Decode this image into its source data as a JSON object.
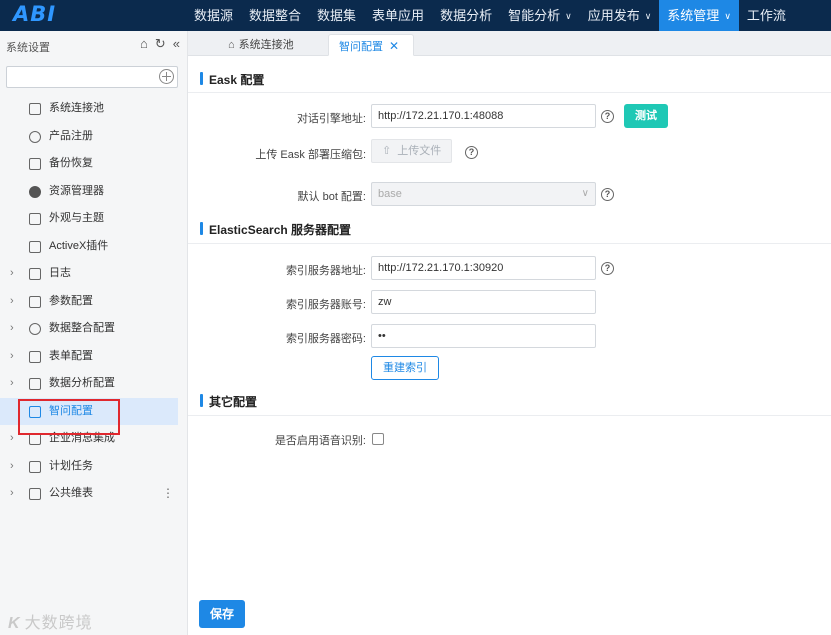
{
  "app": {
    "logo": "ABI"
  },
  "topnav": [
    {
      "label": "数据源"
    },
    {
      "label": "数据整合"
    },
    {
      "label": "数据集"
    },
    {
      "label": "表单应用"
    },
    {
      "label": "数据分析"
    },
    {
      "label": "智能分析"
    },
    {
      "label": "应用发布"
    },
    {
      "label": "系统管理",
      "active": true
    },
    {
      "label": "工作流"
    }
  ],
  "sidebar": {
    "title": "系统设置",
    "search": {
      "value": "",
      "placeholder": ""
    },
    "items": [
      {
        "label": "系统连接池"
      },
      {
        "label": "产品注册"
      },
      {
        "label": "备份恢复"
      },
      {
        "label": "资源管理器"
      },
      {
        "label": "外观与主题"
      },
      {
        "label": "ActiveX插件"
      },
      {
        "label": "日志"
      },
      {
        "label": "参数配置"
      },
      {
        "label": "数据整合配置"
      },
      {
        "label": "表单配置"
      },
      {
        "label": "数据分析配置"
      },
      {
        "label": "智问配置"
      },
      {
        "label": "企业消息集成"
      },
      {
        "label": "计划任务"
      },
      {
        "label": "公共维表"
      }
    ]
  },
  "tabs": [
    {
      "label": "系统连接池"
    },
    {
      "label": "智问配置"
    }
  ],
  "eask": {
    "title": "Eask 配置",
    "engine_label": "对话引擎地址:",
    "engine_value": "http://172.21.170.1:48088",
    "test_button": "测试",
    "upload_label": "上传 Eask 部署压缩包:",
    "upload_button": "上传文件",
    "bot_label": "默认 bot 配置:",
    "bot_value": "base"
  },
  "es": {
    "title": "ElasticSearch 服务器配置",
    "addr_label": "索引服务器地址:",
    "addr_value": "http://172.21.170.1:30920",
    "account_label": "索引服务器账号:",
    "account_value": "zw",
    "password_label": "索引服务器密码:",
    "password_value": "••",
    "rebuild_button": "重建索引"
  },
  "other": {
    "title": "其它配置",
    "voice_label": "是否启用语音识别:",
    "voice_checked": false
  },
  "save_button": "保存",
  "watermark": {
    "logo": "K",
    "text": "大数跨境"
  },
  "colors": {
    "accent": "#1e88e5",
    "topbar": "#0b2a4d",
    "test_button": "#1fc8b5",
    "highlight": "#e0282e"
  }
}
